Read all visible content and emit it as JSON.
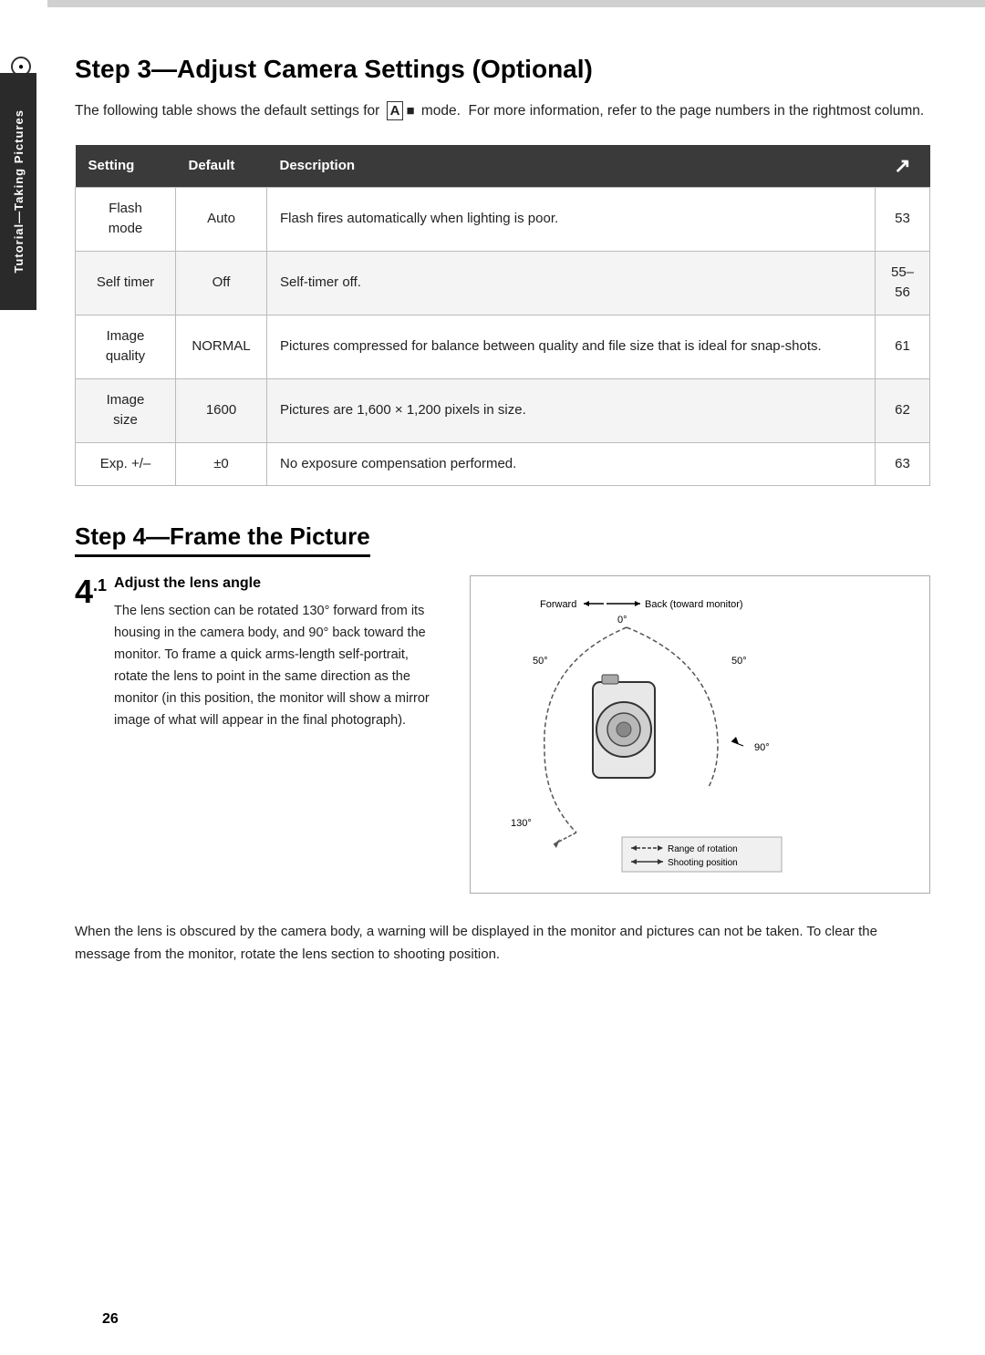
{
  "page": {
    "number": "26",
    "top_accent_color": "#c8c8c8"
  },
  "sidebar": {
    "tab_bg": "#2a2a2a",
    "icon_label": "●",
    "text": "Tutorial—Taking Pictures"
  },
  "step3": {
    "heading": "Step 3—Adjust Camera Settings (Optional)",
    "intro_text": "The following table shows the default settings for",
    "intro_mode": "A",
    "intro_text2": "mode.  For more infor-mation, refer to the page numbers in the rightmost column.",
    "table": {
      "headers": {
        "setting": "Setting",
        "default": "Default",
        "description": "Description",
        "page_icon": "↗"
      },
      "rows": [
        {
          "setting": "Flash\nmode",
          "default": "Auto",
          "description": "Flash fires automatically when lighting is poor.",
          "page": "53"
        },
        {
          "setting": "Self timer",
          "default": "Off",
          "description": "Self-timer off.",
          "page": "55–56"
        },
        {
          "setting": "Image\nquality",
          "default": "NORMAL",
          "description": "Pictures compressed for balance between quality and file size that is ideal for snap-shots.",
          "page": "61"
        },
        {
          "setting": "Image\nsize",
          "default": "1600",
          "description": "Pictures are 1,600 × 1,200 pixels in size.",
          "page": "62"
        },
        {
          "setting": "Exp. +/–",
          "default": "±0",
          "description": "No exposure compensation performed.",
          "page": "63"
        }
      ]
    }
  },
  "step4": {
    "heading": "Step 4—Frame the Picture",
    "substep1": {
      "number": "4",
      "sup": ".1",
      "title": "Adjust the lens angle",
      "body": "The lens section can be rotated 130° forward from its housing in the camera body, and 90° back toward the monitor.  To frame a quick arms-length self-portrait, rotate the lens to point in the same direction as the monitor (in this position, the monitor will show a mirror image of what will appear in the final photograph).",
      "diagram": {
        "labels": {
          "forward": "Forward",
          "back": "Back (toward monitor)",
          "deg0": "0°",
          "deg50_left": "50°",
          "deg50_right": "50°",
          "deg90": "90°",
          "deg130": "130°",
          "range_of_rotation": "Range of rotation",
          "shooting_position": "Shooting position"
        }
      }
    },
    "bottom_text": "When the lens is obscured by the camera body, a warning will be displayed in the monitor and pictures can not be taken.  To clear the message from the monitor, rotate the lens section to shooting position."
  }
}
